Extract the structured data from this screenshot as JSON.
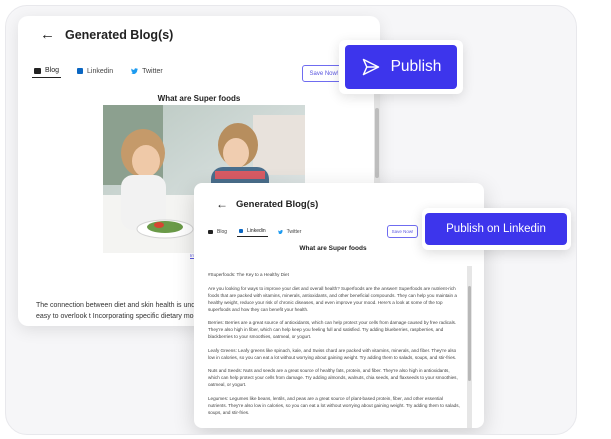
{
  "back_window": {
    "title": "Generated Blog(s)",
    "tabs": [
      {
        "label": "Blog",
        "icon": "blog-icon",
        "active": true
      },
      {
        "label": "Linkedin",
        "icon": "linkedin-icon",
        "active": false
      },
      {
        "label": "Twitter",
        "icon": "twitter-icon",
        "active": false
      }
    ],
    "save_label": "Save Now!",
    "doc_title": "What are Super foods",
    "image_caption": "Image",
    "paragraph": "The connection between diet and skin health is undeniable. flawless skin seems never-ending. It is easy to overlook t Incorporating specific dietary modifications can further e"
  },
  "front_window": {
    "title": "Generated Blog(s)",
    "tabs": [
      {
        "label": "Blog",
        "icon": "blog-icon",
        "active": false
      },
      {
        "label": "Linkedin",
        "icon": "linkedin-icon",
        "active": true
      },
      {
        "label": "Twitter",
        "icon": "twitter-icon",
        "active": false
      }
    ],
    "save_label": "Save Now!",
    "doc_title": "What are Super foods",
    "paragraphs": [
      "#Superfoods: The Key to a Healthy Diet",
      "Are you looking for ways to improve your diet and overall health? Superfoods are the answer! Superfoods are nutrient-rich foods that are packed with vitamins, minerals, antioxidants, and other beneficial compounds. They can help you maintain a healthy weight, reduce your risk of chronic diseases, and even improve your mood. Here's a look at some of the top superfoods and how they can benefit your health.",
      "Berries: Berries are a great source of antioxidants, which can help protect your cells from damage caused by free radicals. They're also high in fiber, which can help keep you feeling full and satisfied. Try adding blueberries, raspberries, and blackberries to your smoothies, oatmeal, or yogurt.",
      "Leafy Greens: Leafy greens like spinach, kale, and Swiss chard are packed with vitamins, minerals, and fiber. They're also low in calories, so you can eat a lot without worrying about gaining weight. Try adding them to salads, soups, and stir-fries.",
      "Nuts and Seeds: Nuts and seeds are a great source of healthy fats, protein, and fiber. They're also high in antioxidants, which can help protect your cells from damage. Try adding almonds, walnuts, chia seeds, and flaxseeds to your smoothies, oatmeal, or yogurt.",
      "Legumes: Legumes like beans, lentils, and peas are a great source of plant-based protein, fiber, and other essential nutrients. They're also low in calories, so you can eat a lot without worrying about gaining weight. Try adding them to salads, soups, and stir-fries."
    ]
  },
  "publish_button": {
    "label": "Publish",
    "icon": "send-icon"
  },
  "publish_linkedin_button": {
    "label": "Publish on Linkedin"
  },
  "colors": {
    "accent": "#3d35ec",
    "linkedin": "#0a66c2",
    "twitter": "#1d9bf0"
  }
}
